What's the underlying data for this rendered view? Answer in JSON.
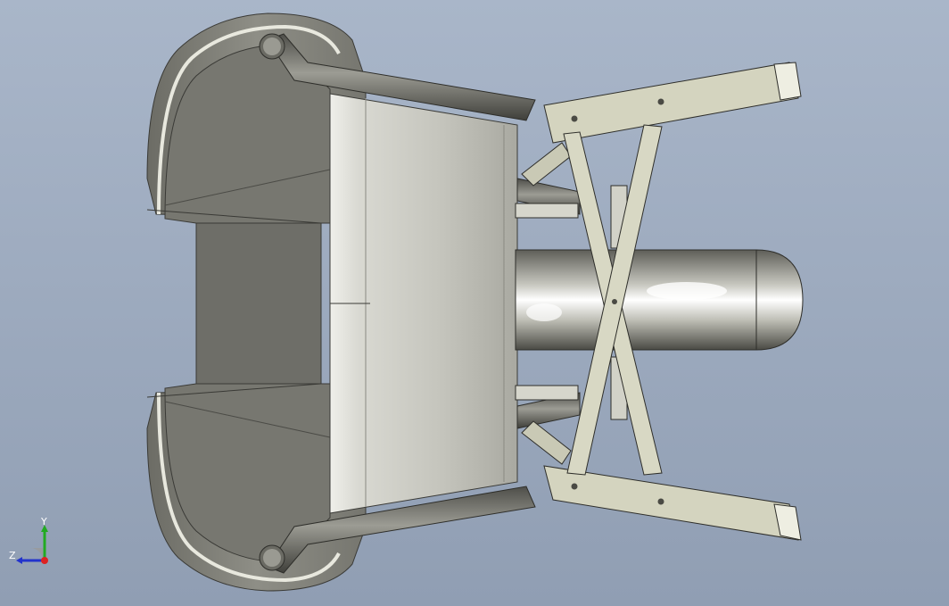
{
  "viewport": {
    "background_top": "#a9b6c9",
    "background_bottom": "#909eb3"
  },
  "model": {
    "body_color": "#8c8c84",
    "panel_color": "#d6d6cc",
    "frame_color": "#c8c8b4",
    "tube_color": "#a7a79f"
  },
  "triad": {
    "x_label": "",
    "y_label": "Y",
    "z_label": "Z",
    "y_color": "#22aa22",
    "z_color": "#2233cc",
    "origin_color": "#dd2222"
  }
}
